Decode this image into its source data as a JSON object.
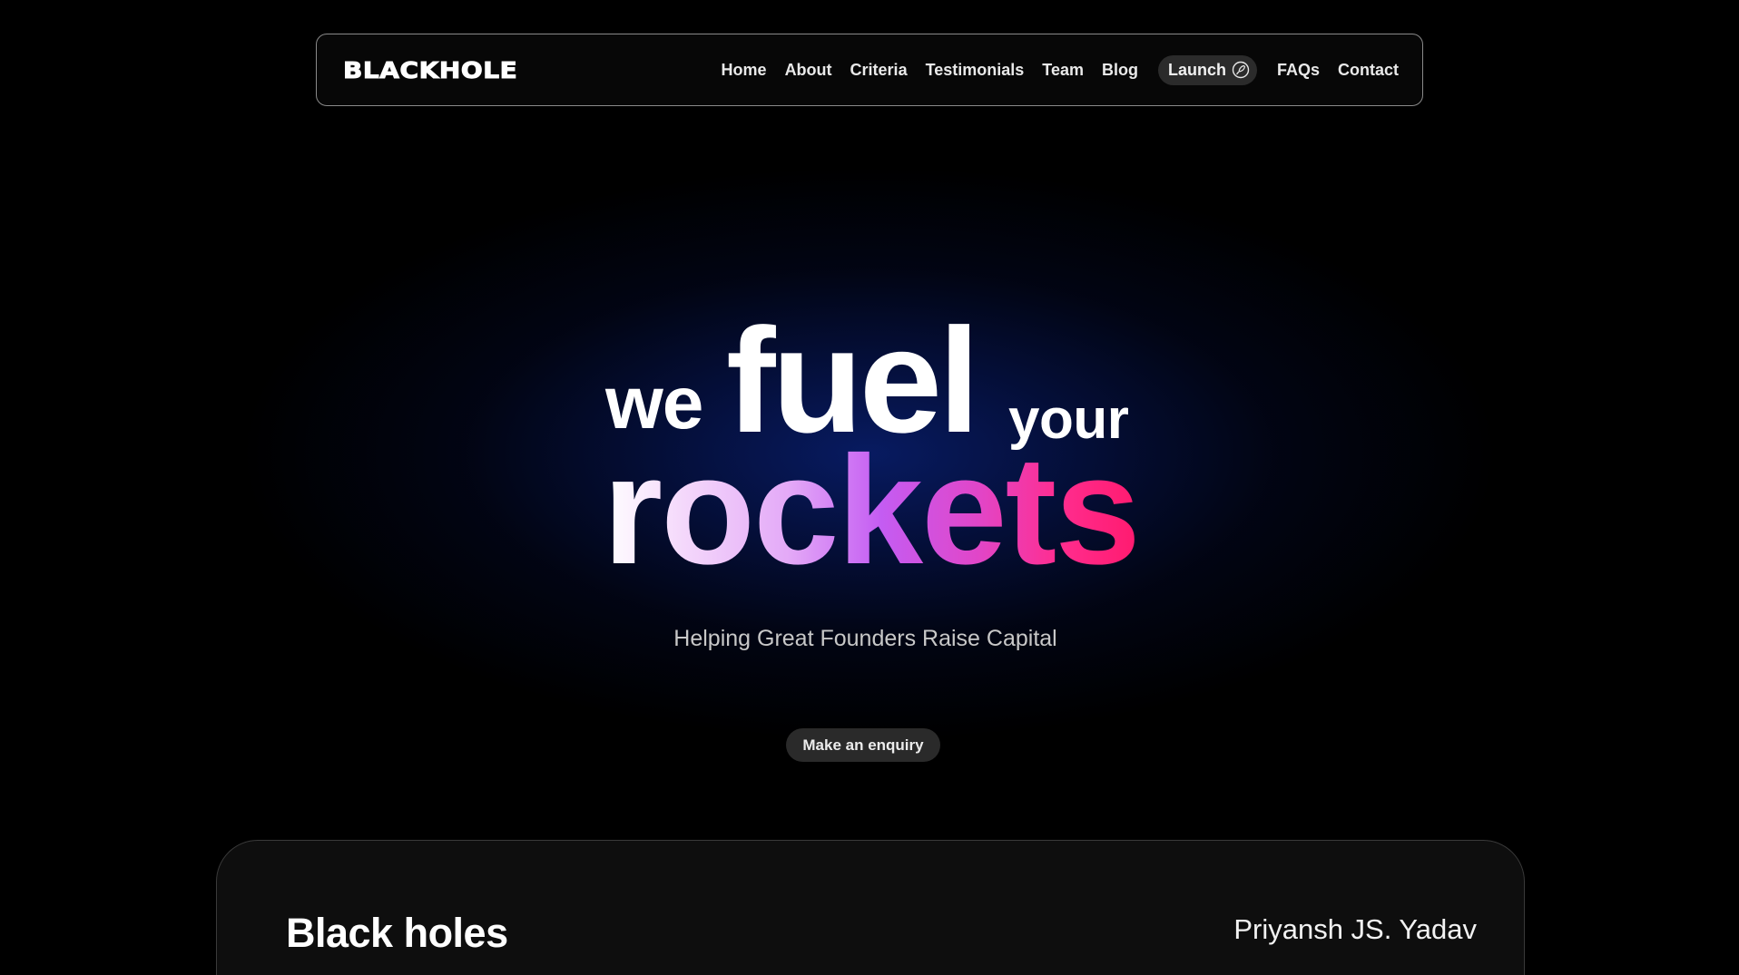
{
  "nav": {
    "logo": "BLACKHOLE",
    "links": [
      "Home",
      "About",
      "Criteria",
      "Testimonials",
      "Team",
      "Blog"
    ],
    "launch": {
      "label": "Launch",
      "icon": "rocket-icon"
    },
    "links_after": [
      "FAQs",
      "Contact"
    ]
  },
  "hero": {
    "we": "we",
    "fuel": "fuel",
    "your": "your",
    "rockets": "rockets",
    "subtitle": "Helping Great Founders Raise Capital",
    "cta": "Make an enquiry"
  },
  "card": {
    "title": "Black holes",
    "author": "Priyansh JS. Yadav"
  },
  "colors": {
    "background": "#000000",
    "glow": "#081c66",
    "gradient_start": "#ffffff",
    "gradient_mid": "#c45cf2",
    "gradient_end": "#ff1a6e",
    "pill": "#2b2b2b"
  }
}
